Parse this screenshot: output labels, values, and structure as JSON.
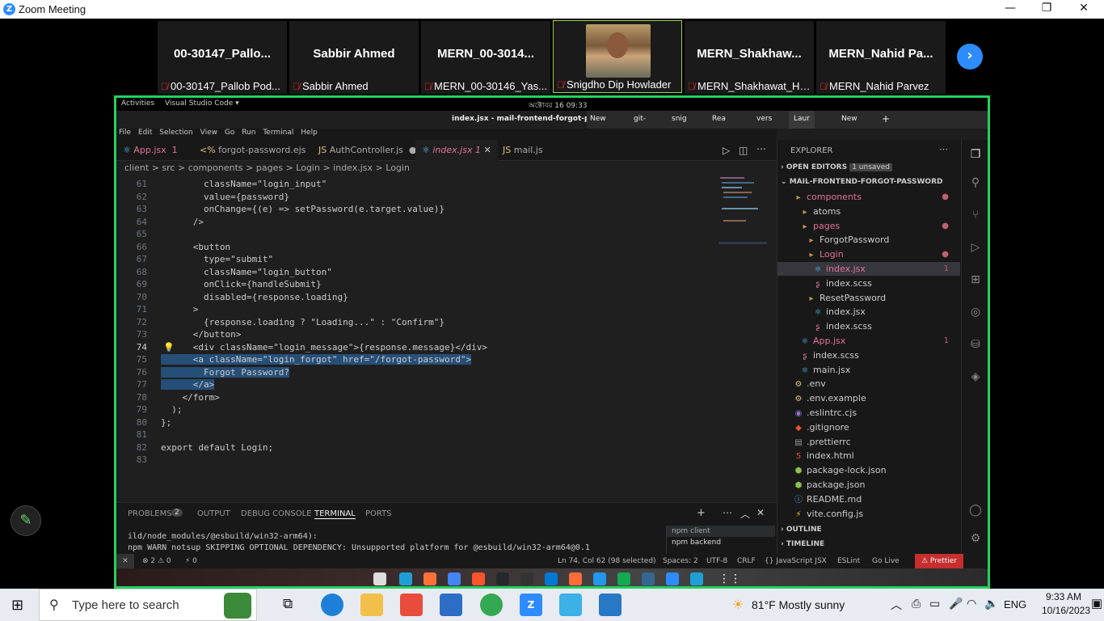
{
  "zoom": {
    "title": "Zoom Meeting",
    "logo": "Z"
  },
  "participants": [
    {
      "display": "00-30147_Pallo...",
      "label": "00-30147_Pallob Pod..."
    },
    {
      "display": "Sabbir Ahmed",
      "label": "Sabbir Ahmed"
    },
    {
      "display": "MERN_00-3014...",
      "label": "MERN_00-30146_Yas..."
    },
    {
      "display": "",
      "label": "Snigdho Dip Howlader"
    },
    {
      "display": "MERN_Shakhaw...",
      "label": "MERN_Shakhawat_Ho..."
    },
    {
      "display": "MERN_Nahid  Pa...",
      "label": "MERN_Nahid Parvez"
    }
  ],
  "gnome": {
    "activities": "Activities",
    "app": "Visual Studio Code ▾",
    "clock": "অক্টোবর 16 09:33"
  },
  "vscode": {
    "window_title": "index.jsx - mail-frontend-forgot-password",
    "browser_tabs": [
      "New",
      "git-",
      "snig",
      "Rea",
      "vers",
      "Laur",
      "New"
    ],
    "menu": [
      "File",
      "Edit",
      "Selection",
      "View",
      "Go",
      "Run",
      "Terminal",
      "Help"
    ],
    "tabs": [
      {
        "label": "App.jsx",
        "badge": "1"
      },
      {
        "label": "forgot-password.ejs",
        "badge": ""
      },
      {
        "label": "AuthController.js",
        "badge": "●"
      },
      {
        "label": "index.jsx",
        "badge": "1"
      },
      {
        "label": "mail.js",
        "badge": ""
      }
    ],
    "breadcrumb": "client > src > components > pages > Login > index.jsx > Login",
    "code": [
      {
        "n": "61",
        "t": "        className=\"login_input\""
      },
      {
        "n": "62",
        "t": "        value={password}"
      },
      {
        "n": "63",
        "t": "        onChange={(e) => setPassword(e.target.value)}"
      },
      {
        "n": "64",
        "t": "      />"
      },
      {
        "n": "65",
        "t": ""
      },
      {
        "n": "66",
        "t": "      <button"
      },
      {
        "n": "67",
        "t": "        type=\"submit\""
      },
      {
        "n": "68",
        "t": "        className=\"login_button\""
      },
      {
        "n": "69",
        "t": "        onClick={handleSubmit}"
      },
      {
        "n": "70",
        "t": "        disabled={response.loading}"
      },
      {
        "n": "71",
        "t": "      >"
      },
      {
        "n": "72",
        "t": "        {response.loading ? \"Loading...\" : \"Confirm\"}"
      },
      {
        "n": "73",
        "t": "      </button>"
      },
      {
        "n": "74",
        "t": "      <div className=\"login_message\">{response.message}</div>"
      },
      {
        "n": "75",
        "t": "      <a className=\"login_forgot\" href=\"/forgot-password\">"
      },
      {
        "n": "76",
        "t": "        Forgot Password?"
      },
      {
        "n": "77",
        "t": "      </a>"
      },
      {
        "n": "78",
        "t": "    </form>"
      },
      {
        "n": "79",
        "t": "  );"
      },
      {
        "n": "80",
        "t": "};"
      },
      {
        "n": "81",
        "t": ""
      },
      {
        "n": "82",
        "t": "export default Login;"
      },
      {
        "n": "83",
        "t": ""
      }
    ],
    "panel": {
      "tabs": [
        "PROBLEMS",
        "OUTPUT",
        "DEBUG CONSOLE",
        "TERMINAL",
        "PORTS"
      ],
      "problems_count": "2",
      "terminal_lines": [
        "ild/node_modules/@esbuild/win32-arm64):",
        "npm WARN notsup SKIPPING OPTIONAL DEPENDENCY: Unsupported platform for @esbuild/win32-arm64@0.1"
      ],
      "terminals": [
        "npm  client",
        "npm  backend"
      ]
    },
    "status": {
      "errors": "⊗ 2 ⚠ 0",
      "ports": "⚡ 0",
      "position": "Ln 74, Col 62 (98 selected)",
      "spaces": "Spaces: 2",
      "encoding": "UTF-8",
      "eol": "CRLF",
      "lang": "{} JavaScript JSX",
      "eslint": "ESLint",
      "golive": "Go Live",
      "prettier": "⚠ Prettier"
    },
    "explorer": {
      "title": "EXPLORER",
      "open_editors": "OPEN EDITORS",
      "unsaved": "1 unsaved",
      "root": "MAIL-FRONTEND-FORGOT-PASSWORD",
      "items": [
        {
          "label": "components",
          "indent": 2,
          "icon": "folder",
          "color": "#e2739b",
          "mark": "●"
        },
        {
          "label": "atoms",
          "indent": 3,
          "icon": "folder",
          "color": "#ccc",
          "mark": ""
        },
        {
          "label": "pages",
          "indent": 3,
          "icon": "folder",
          "color": "#e2739b",
          "mark": "●"
        },
        {
          "label": "ForgotPassword",
          "indent": 4,
          "icon": "folder",
          "color": "#ccc",
          "mark": ""
        },
        {
          "label": "Login",
          "indent": 4,
          "icon": "folder",
          "color": "#e2739b",
          "mark": "●"
        },
        {
          "label": "index.jsx",
          "indent": 5,
          "icon": "react",
          "color": "#e2739b",
          "mark": "1"
        },
        {
          "label": "index.scss",
          "indent": 5,
          "icon": "sass",
          "color": "#ccc",
          "mark": ""
        },
        {
          "label": "ResetPassword",
          "indent": 4,
          "icon": "folder",
          "color": "#ccc",
          "mark": ""
        },
        {
          "label": "index.jsx",
          "indent": 5,
          "icon": "react",
          "color": "#ccc",
          "mark": ""
        },
        {
          "label": "index.scss",
          "indent": 5,
          "icon": "sass",
          "color": "#ccc",
          "mark": ""
        },
        {
          "label": "App.jsx",
          "indent": 3,
          "icon": "react",
          "color": "#e2739b",
          "mark": "1"
        },
        {
          "label": "index.scss",
          "indent": 3,
          "icon": "sass",
          "color": "#ccc",
          "mark": ""
        },
        {
          "label": "main.jsx",
          "indent": 3,
          "icon": "react",
          "color": "#ccc",
          "mark": ""
        },
        {
          "label": ".env",
          "indent": 2,
          "icon": "env",
          "color": "#ccc",
          "mark": ""
        },
        {
          "label": ".env.example",
          "indent": 2,
          "icon": "env",
          "color": "#ccc",
          "mark": ""
        },
        {
          "label": ".eslintrc.cjs",
          "indent": 2,
          "icon": "eslint",
          "color": "#ccc",
          "mark": ""
        },
        {
          "label": ".gitignore",
          "indent": 2,
          "icon": "git",
          "color": "#ccc",
          "mark": ""
        },
        {
          "label": ".prettierrc",
          "indent": 2,
          "icon": "prettier",
          "color": "#ccc",
          "mark": ""
        },
        {
          "label": "index.html",
          "indent": 2,
          "icon": "html",
          "color": "#ccc",
          "mark": ""
        },
        {
          "label": "package-lock.json",
          "indent": 2,
          "icon": "npm",
          "color": "#ccc",
          "mark": ""
        },
        {
          "label": "package.json",
          "indent": 2,
          "icon": "npm",
          "color": "#ccc",
          "mark": ""
        },
        {
          "label": "README.md",
          "indent": 2,
          "icon": "info",
          "color": "#ccc",
          "mark": ""
        },
        {
          "label": "vite.config.js",
          "indent": 2,
          "icon": "vite",
          "color": "#ccc",
          "mark": ""
        }
      ],
      "outline": "OUTLINE",
      "timeline": "TIMELINE"
    }
  },
  "taskbar": {
    "search_placeholder": "Type here to search",
    "weather": "81°F  Mostly sunny",
    "lang": "ENG",
    "time": "9:33 AM",
    "date": "10/16/2023",
    "notif": "2"
  }
}
